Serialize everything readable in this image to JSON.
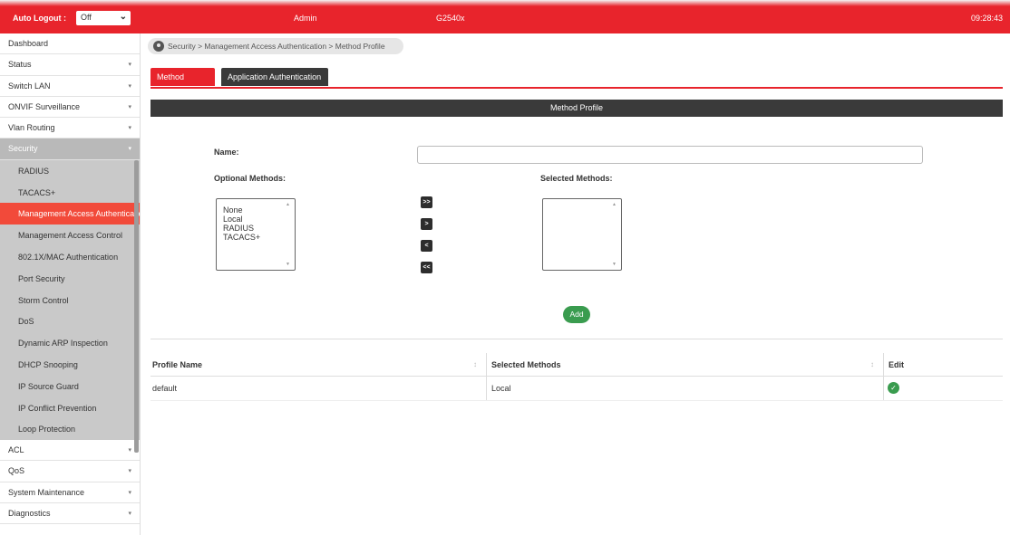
{
  "topbar": {
    "auto_logout_label": "Auto Logout :",
    "auto_logout_value": "Off",
    "user": "Admin",
    "model": "G2540x",
    "time": "09:28:43"
  },
  "sidebar": {
    "items_top": [
      {
        "label": "Dashboard",
        "chev": ""
      },
      {
        "label": "Status",
        "chev": "▾"
      },
      {
        "label": "Switch LAN",
        "chev": "▾"
      },
      {
        "label": "ONVIF Surveillance",
        "chev": "▾"
      },
      {
        "label": "Vlan Routing",
        "chev": "▾"
      }
    ],
    "security": {
      "label": "Security",
      "chev": "▾"
    },
    "security_sub": [
      "RADIUS",
      "TACACS+",
      "Management Access Authenticatio",
      "Management Access Control",
      "802.1X/MAC Authentication",
      "Port Security",
      "Storm Control",
      "DoS",
      "Dynamic ARP Inspection",
      "DHCP Snooping",
      "IP Source Guard",
      "IP Conflict Prevention",
      "Loop Protection"
    ],
    "items_bottom": [
      {
        "label": "ACL",
        "chev": "▾"
      },
      {
        "label": "QoS",
        "chev": "▾"
      },
      {
        "label": "System Maintenance",
        "chev": "▾"
      },
      {
        "label": "Diagnostics",
        "chev": "▾"
      }
    ]
  },
  "breadcrumb": "Security > Management Access Authentication > Method Profile",
  "tabs": {
    "method_profile": "Method Profile",
    "application_authentication": "Application Authentication"
  },
  "section_title": "Method Profile",
  "form": {
    "name_label": "Name:",
    "name_value": "",
    "optional_label": "Optional Methods:",
    "selected_label": "Selected Methods:",
    "optional_methods": [
      "None",
      "Local",
      "RADIUS",
      "TACACS+"
    ],
    "move_all_right": ">>",
    "move_right": ">",
    "move_left": "<",
    "move_all_left": "<<",
    "add_label": "Add"
  },
  "table": {
    "headers": [
      "Profile Name",
      "Selected Methods",
      "Edit"
    ],
    "sort_glyph": "↕",
    "rows": [
      {
        "profile_name": "default",
        "selected_methods": "Local"
      }
    ]
  },
  "colors": {
    "brand_red": "#e8242c",
    "active_item": "#f24a3a",
    "dark_bar": "#3a3a3a",
    "green": "#3a9c4f"
  },
  "icons": {
    "breadcrumb": "location-pin-icon",
    "edit": "edit-check-icon",
    "dropdown": "chevron-down-icon"
  }
}
